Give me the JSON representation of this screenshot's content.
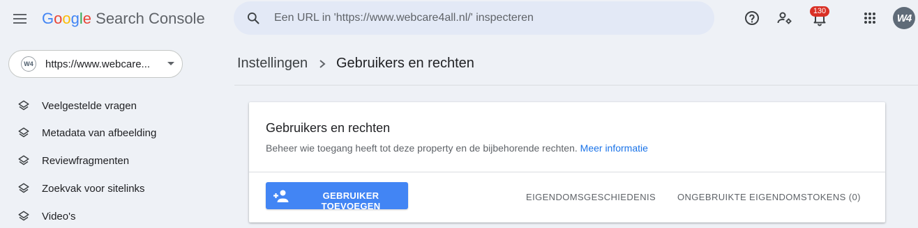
{
  "header": {
    "logo": {
      "g1": "G",
      "o1": "o",
      "o2": "o",
      "g2": "g",
      "l": "l",
      "e": "e",
      "product": "Search Console"
    },
    "search": {
      "placeholder": "Een URL in 'https://www.webcare4all.nl/' inspecteren"
    },
    "notifications": {
      "count": "130"
    },
    "avatar": {
      "initials": "W4"
    },
    "icons": [
      "menu-icon",
      "search-icon",
      "help-icon",
      "manage-accounts-icon",
      "notifications-icon",
      "apps-grid-icon"
    ]
  },
  "property": {
    "label": "https://www.webcare...",
    "logo_text": "W4"
  },
  "sidebar": {
    "items": [
      {
        "label": "Veelgestelde vragen",
        "icon": "layers-icon"
      },
      {
        "label": "Metadata van afbeelding",
        "icon": "layers-icon"
      },
      {
        "label": "Reviewfragmenten",
        "icon": "layers-icon"
      },
      {
        "label": "Zoekvak voor sitelinks",
        "icon": "layers-icon"
      },
      {
        "label": "Video's",
        "icon": "layers-icon"
      }
    ]
  },
  "breadcrumb": {
    "parent": "Instellingen",
    "current": "Gebruikers en rechten"
  },
  "card": {
    "title": "Gebruikers en rechten",
    "description": "Beheer wie toegang heeft tot deze property en de bijbehorende rechten.",
    "link": "Meer informatie",
    "add_user_button": "GEBRUIKER TOEVOEGEN",
    "history_button": "EIGENDOMSGESCHIEDENIS",
    "unused_tokens_button": "ONGEBRUIKTE EIGENDOMSTOKENS (0)"
  },
  "colors": {
    "accent": "#4285f4",
    "link": "#1a73e8",
    "badge": "#d93025",
    "background": "#eef1f6"
  }
}
